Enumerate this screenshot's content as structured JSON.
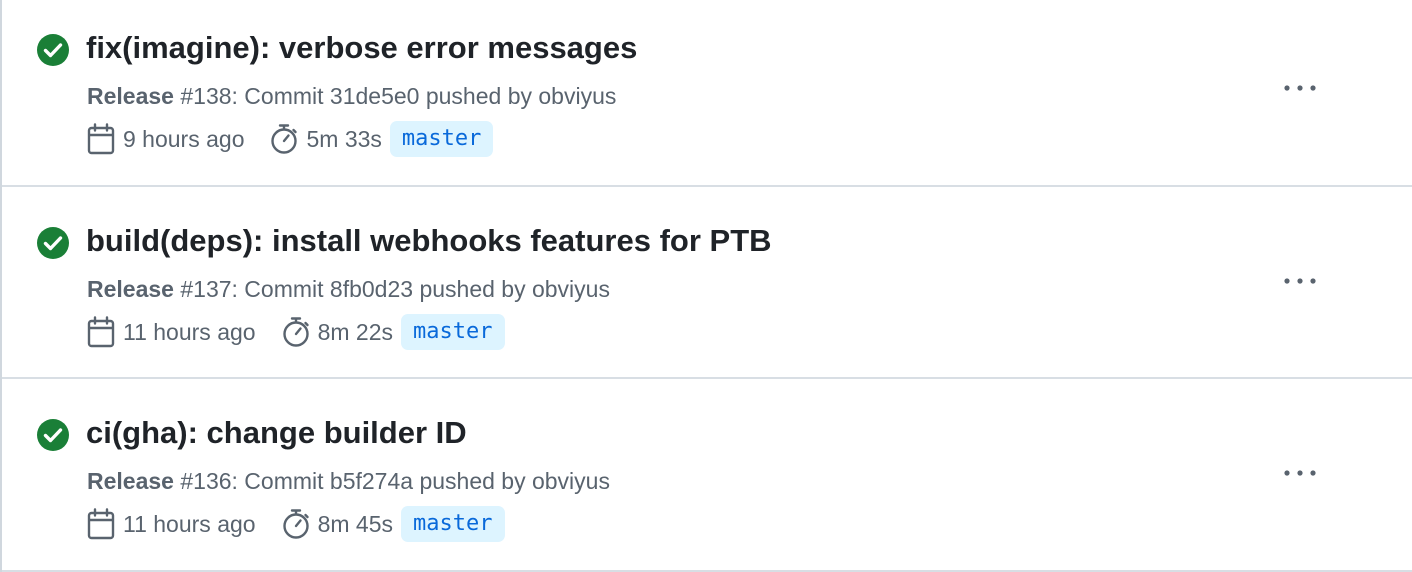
{
  "colors": {
    "success": "#1a7f37",
    "branch_bg": "#ddf4ff",
    "branch_fg": "#0969da",
    "muted": "#59636e",
    "text": "#1f2328"
  },
  "runs": [
    {
      "status_icon": "check-circle-fill-icon",
      "title": "fix(imagine): verbose error messages",
      "workflow": "Release",
      "run_info": " #138: Commit 31de5e0 pushed by obviyus",
      "time_ago": "9 hours ago",
      "duration": "5m 33s",
      "branch": "master",
      "more_icon": "kebab-horizontal-icon"
    },
    {
      "status_icon": "check-circle-fill-icon",
      "title": "build(deps): install webhooks features for PTB",
      "workflow": "Release",
      "run_info": " #137: Commit 8fb0d23 pushed by obviyus",
      "time_ago": "11 hours ago",
      "duration": "8m 22s",
      "branch": "master",
      "more_icon": "kebab-horizontal-icon"
    },
    {
      "status_icon": "check-circle-fill-icon",
      "title": "ci(gha): change builder ID",
      "workflow": "Release",
      "run_info": " #136: Commit b5f274a pushed by obviyus",
      "time_ago": "11 hours ago",
      "duration": "8m 45s",
      "branch": "master",
      "more_icon": "kebab-horizontal-icon"
    }
  ]
}
